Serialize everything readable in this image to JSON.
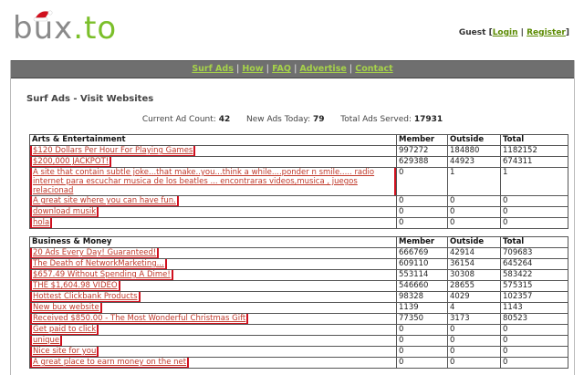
{
  "logo": {
    "part1": "bux",
    "dot": ".",
    "part2": "to"
  },
  "user": {
    "label": "Guest",
    "login": "Login",
    "register": "Register"
  },
  "nav": [
    "Surf Ads",
    "How",
    "FAQ",
    "Advertise",
    "Contact"
  ],
  "page_title": "Surf Ads - Visit Websites",
  "stats": {
    "current_label": "Current Ad Count:",
    "current": "42",
    "today_label": "New Ads Today:",
    "today": "79",
    "total_label": "Total Ads Served:",
    "total": "17931"
  },
  "columns": {
    "member": "Member",
    "outside": "Outside",
    "total": "Total"
  },
  "categories": [
    {
      "name": "Arts & Entertainment",
      "rows": [
        {
          "title": "$120 Dollars Per Hour For Playing Games",
          "member": "997272",
          "outside": "184880",
          "total": "1182152"
        },
        {
          "title": "$200,000 JACKPOT!",
          "member": "629388",
          "outside": "44923",
          "total": "674311"
        },
        {
          "title": "A site that contain subtle joke...that make..you...think a while....ponder n smile..... radio internet para escuchar musica de los beatles ... encontraras videos,musica , juegos relacionad",
          "member": "0",
          "outside": "1",
          "total": "1",
          "tall": true
        },
        {
          "title": "A great site where you can have fun.",
          "member": "0",
          "outside": "0",
          "total": "0"
        },
        {
          "title": "download musik",
          "member": "0",
          "outside": "0",
          "total": "0"
        },
        {
          "title": "hola",
          "member": "0",
          "outside": "0",
          "total": "0"
        }
      ]
    },
    {
      "name": "Business & Money",
      "rows": [
        {
          "title": "20 Ads Every Day! Guaranteed!",
          "member": "666769",
          "outside": "42914",
          "total": "709683"
        },
        {
          "title": "The Death of NetworkMarketing...",
          "member": "609110",
          "outside": "36154",
          "total": "645264"
        },
        {
          "title": "$657.49 Without Spending A Dime!",
          "member": "553114",
          "outside": "30308",
          "total": "583422"
        },
        {
          "title": "THE $1,604.98 VIDEO",
          "member": "546660",
          "outside": "28655",
          "total": "575315"
        },
        {
          "title": "Hottest Clickbank Products",
          "member": "98328",
          "outside": "4029",
          "total": "102357"
        },
        {
          "title": "New bux website",
          "member": "1139",
          "outside": "4",
          "total": "1143"
        },
        {
          "title": "Received $850.00 - The Most Wonderful Christmas Gift",
          "member": "77350",
          "outside": "3173",
          "total": "80523"
        },
        {
          "title": "Get paid to click",
          "member": "0",
          "outside": "0",
          "total": "0"
        },
        {
          "title": "unique",
          "member": "0",
          "outside": "0",
          "total": "0"
        },
        {
          "title": "Nice site for you",
          "member": "0",
          "outside": "0",
          "total": "0"
        },
        {
          "title": "A great place to earn money on the net",
          "member": "0",
          "outside": "0",
          "total": "0"
        }
      ]
    }
  ]
}
